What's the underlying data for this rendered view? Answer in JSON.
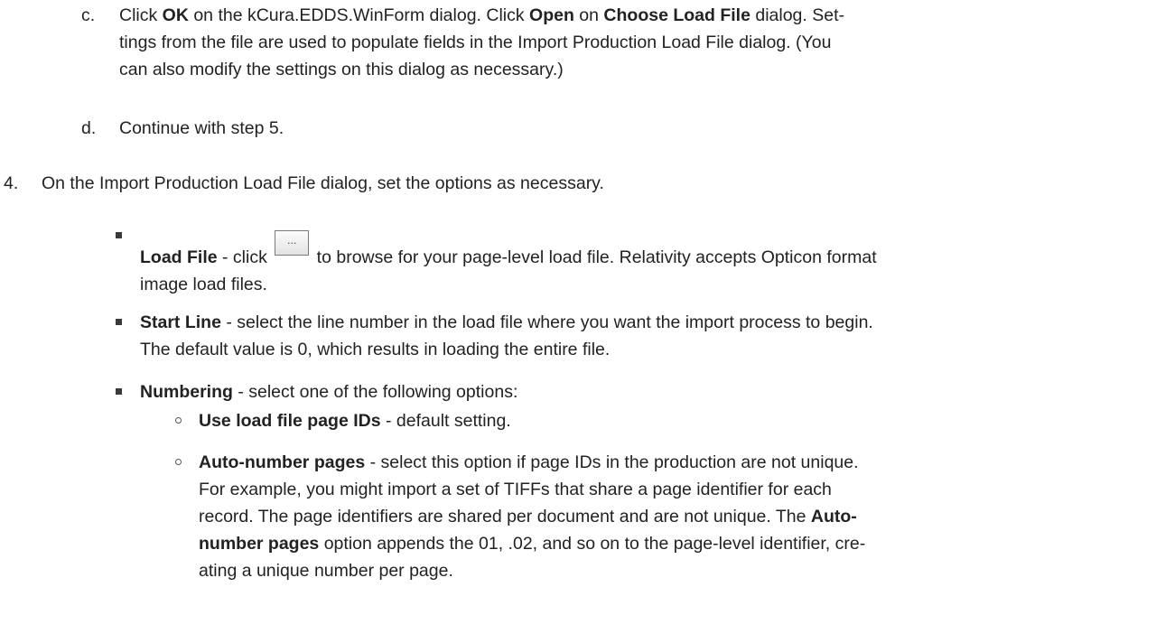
{
  "step_c": {
    "marker": "c.",
    "t1": "Click ",
    "b1": "OK",
    "t2": " on the kCura.EDDS.WinForm dialog. Click ",
    "b2": "Open",
    "t3": " on ",
    "b3": "Choose Load File",
    "t4": " dialog. Set-",
    "line2": "tings from the file are used to populate fields in the Import Production Load File dialog. (You",
    "line3": "can also modify the settings on this dialog as necessary.)"
  },
  "step_d": {
    "marker": "d.",
    "text": "Continue with step 5."
  },
  "step_4": {
    "marker": "4.",
    "text": "On the Import Production Load File dialog, set the options as necessary."
  },
  "load_file": {
    "label": "Load File",
    "t1": " - click ",
    "button_glyph": "...",
    "t2": " to browse for your page-level load file. Relativity accepts Opticon format",
    "line2": "image load files."
  },
  "start_line": {
    "label": "Start Line",
    "t1": " - select the line number in the load file where you want the import process to begin.",
    "line2": "The default value is 0, which results in loading the entire file."
  },
  "numbering": {
    "label": "Numbering",
    "t1": " - select one of the following options:"
  },
  "use_load_file": {
    "label": "Use load file page IDs",
    "t1": " - default setting."
  },
  "auto_number": {
    "label": "Auto-number pages",
    "t1": " - select this option if page IDs in the production are not unique.",
    "line2": "For example, you might import a set of TIFFs that share a page identifier for each",
    "line3a": "record. The page identifiers are shared per document and are not unique. The ",
    "label2a": "Auto-",
    "label2b": "number pages",
    "line4b": " option appends the 01, .02, and so on to the page-level identifier, cre-",
    "line5": "ating a unique number per page."
  }
}
